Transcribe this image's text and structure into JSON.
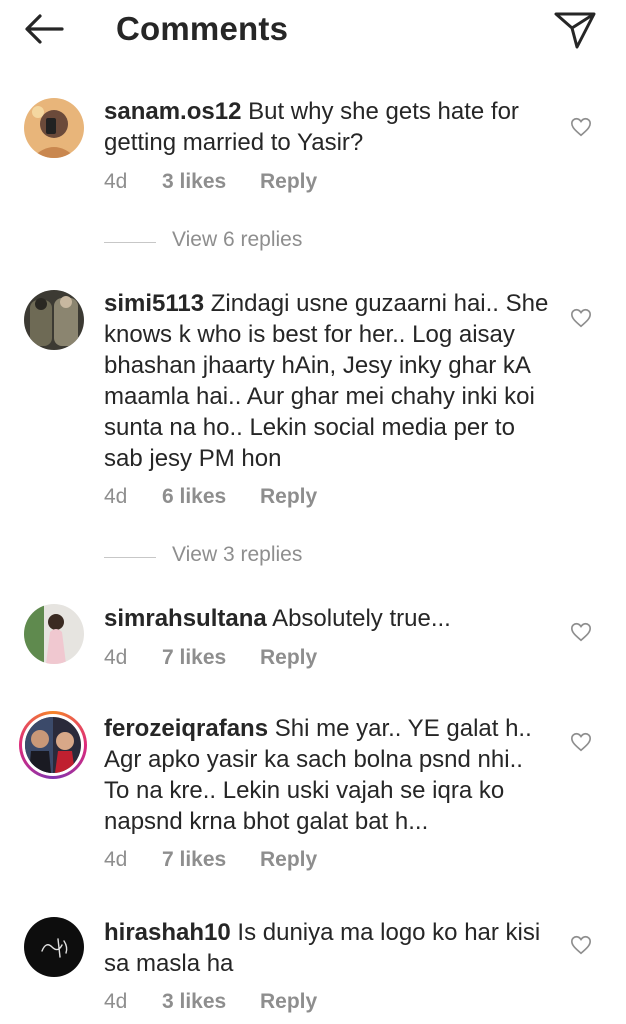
{
  "header": {
    "title": "Comments"
  },
  "comments": [
    {
      "username": "sanam.os12",
      "text": "But why she gets hate for getting married to Yasir?",
      "time": "4d",
      "likes": "3 likes",
      "reply": "Reply",
      "view_replies": "View 6 replies"
    },
    {
      "username": "simi5113",
      "text": "Zindagi usne guzaarni hai.. She knows k who is best for her.. Log aisay bhashan jhaarty hAin, Jesy inky ghar kA maamla hai.. Aur ghar mei chahy inki koi sunta na ho.. Lekin social media per to sab jesy PM hon",
      "time": "4d",
      "likes": "6 likes",
      "reply": "Reply",
      "view_replies": "View 3 replies"
    },
    {
      "username": "simrahsultana",
      "text": "Absolutely true...",
      "time": "4d",
      "likes": "7 likes",
      "reply": "Reply"
    },
    {
      "username": "ferozeiqrafans",
      "text": "Shi me yar.. YE galat h.. Agr apko yasir ka sach bolna psnd nhi.. To na kre.. Lekin uski vajah se iqra ko napsnd krna bhot galat bat h...",
      "time": "4d",
      "likes": "7 likes",
      "reply": "Reply"
    },
    {
      "username": "hirashah10",
      "text": "Is duniya ma logo ko har kisi sa masla ha",
      "time": "4d",
      "likes": "3 likes",
      "reply": "Reply"
    }
  ],
  "colors": {
    "text": "#262626",
    "secondary": "#8e8e8e",
    "story_ring": "#e1306c"
  }
}
